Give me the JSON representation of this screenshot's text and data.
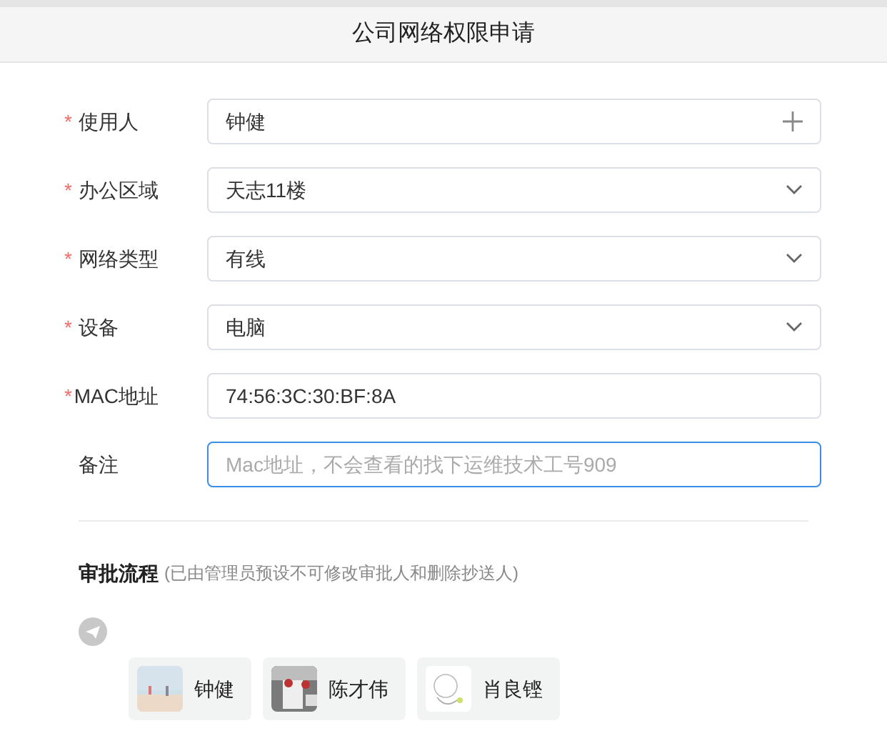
{
  "header": {
    "title": "公司网络权限申请"
  },
  "fields": [
    {
      "label": "使用人",
      "required": true,
      "kind": "picker",
      "value": "钟健",
      "focused": false
    },
    {
      "label": "办公区域",
      "required": true,
      "kind": "select",
      "value": "天志11楼",
      "focused": false
    },
    {
      "label": "网络类型",
      "required": true,
      "kind": "select",
      "value": "有线",
      "focused": false
    },
    {
      "label": "设备",
      "required": true,
      "kind": "select",
      "value": "电脑",
      "focused": false
    },
    {
      "label": "MAC地址",
      "required": true,
      "kind": "text",
      "value": "74:56:3C:30:BF:8A",
      "focused": false
    },
    {
      "label": "备注",
      "required": false,
      "kind": "text",
      "placeholder": "Mac地址，不会查看的找下运维技术工号909",
      "focused": true
    }
  ],
  "required_mark": "*",
  "approval": {
    "title": "审批流程",
    "note": "(已由管理员预设不可修改审批人和删除抄送人)",
    "people": [
      {
        "name": "钟健"
      },
      {
        "name": "陈才伟"
      },
      {
        "name": "肖良铿"
      }
    ]
  }
}
